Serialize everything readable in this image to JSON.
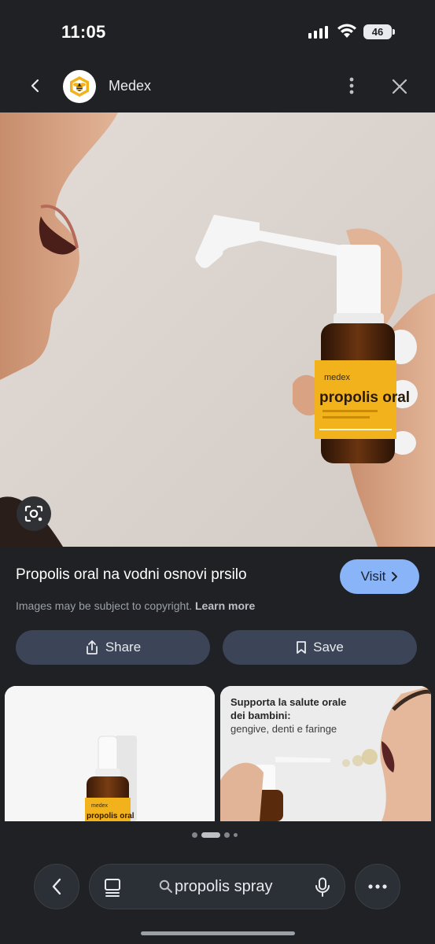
{
  "status_bar": {
    "time": "11:05",
    "battery": "46"
  },
  "header": {
    "site_name": "Medex"
  },
  "result": {
    "title": "Propolis oral na vodni osnovi prsilo",
    "visit_label": "Visit",
    "copyright_text": "Images may be subject to copyright.",
    "learn_more": "Learn more",
    "share_label": "Share",
    "save_label": "Save"
  },
  "product": {
    "brand": "medex",
    "name": "propolis oral"
  },
  "related": [
    {
      "brand": "medex",
      "name": "propolis oral"
    },
    {
      "headline": "Supporta la salute orale dei bambini:",
      "subline": "gengive, denti e faringe"
    }
  ],
  "carousel": {
    "active_index": 1,
    "count": 4
  },
  "bottom_bar": {
    "search_query": "propolis spray"
  },
  "colors": {
    "accent": "#8ab4f8",
    "background": "#202124",
    "pill": "#3c4557",
    "label_yellow": "#f2b21c"
  }
}
